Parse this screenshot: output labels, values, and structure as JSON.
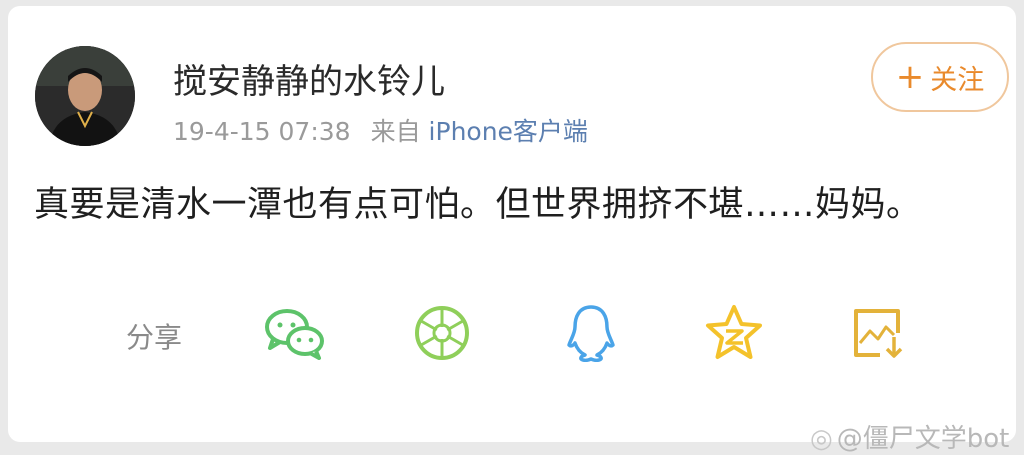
{
  "post": {
    "username": "搅安静静的水铃儿",
    "timestamp": "19-4-15 07:38",
    "from_label": "来自",
    "source": "iPhone客户端",
    "follow_button": {
      "plus": "+",
      "label": "关注"
    },
    "text": "真要是清水一潭也有点可怕。但世界拥挤不堪……妈妈。"
  },
  "share": {
    "label": "分享",
    "icons": [
      "wechat-icon",
      "moments-icon",
      "qq-icon",
      "qzone-icon",
      "save-image-icon"
    ]
  },
  "watermark": "@僵尸文学bot",
  "colors": {
    "accent_orange": "#e98a2c",
    "wechat_green": "#5dc36a",
    "moments_green": "#8fcf5a",
    "qq_blue": "#4aa4e8",
    "qzone_yellow": "#f4c22b",
    "save_gold": "#e3b23a",
    "link_blue": "#5c7fb0"
  }
}
